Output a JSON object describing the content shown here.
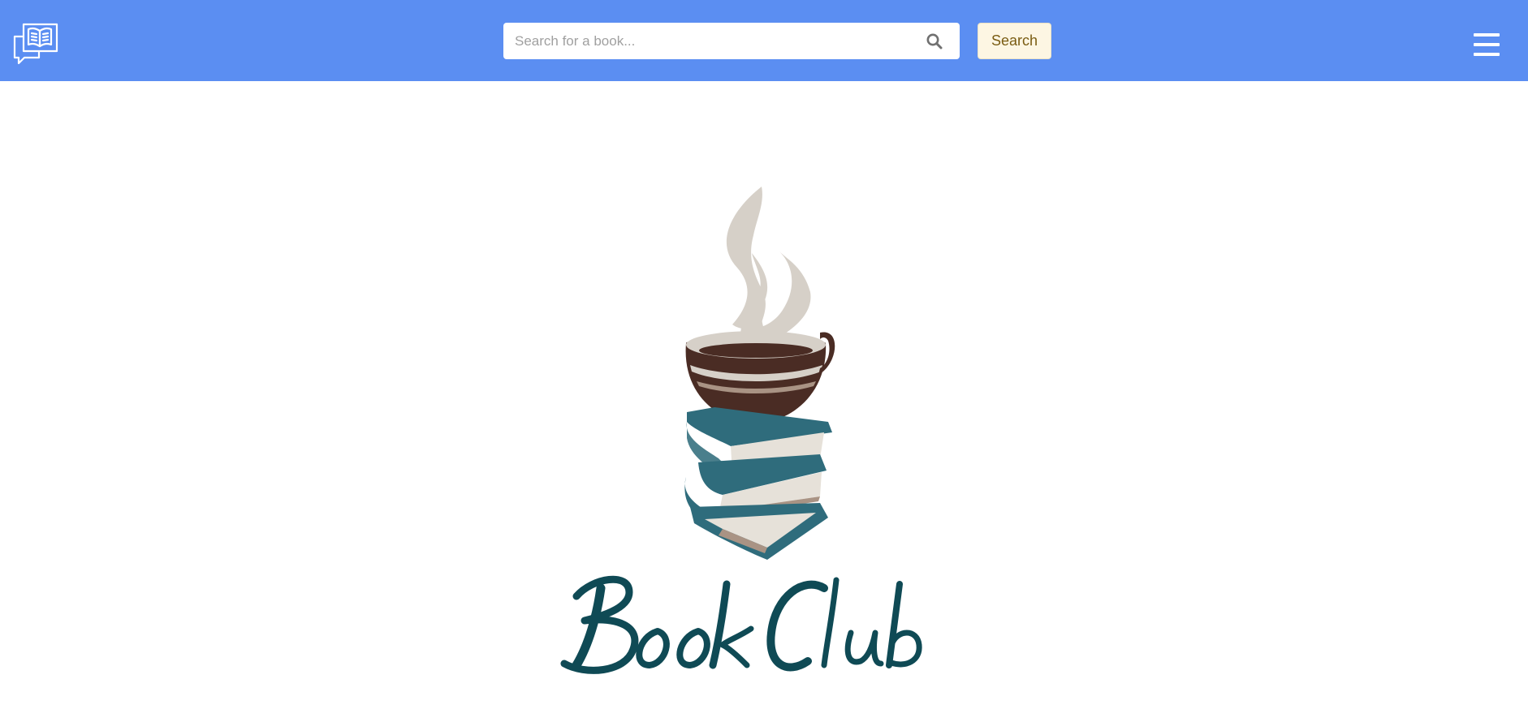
{
  "header": {
    "bg_color": "#5b8ef2",
    "logo_icon": "open-book-chat-icon",
    "search": {
      "placeholder": "Search for a book...",
      "value": "",
      "icon": "search-icon"
    },
    "search_button_label": "Search",
    "menu_icon": "hamburger-menu-icon"
  },
  "hero": {
    "logo_text": "Book Club",
    "illustration": "coffee-cup-on-books-illustration",
    "title_color": "#0f4a55"
  }
}
